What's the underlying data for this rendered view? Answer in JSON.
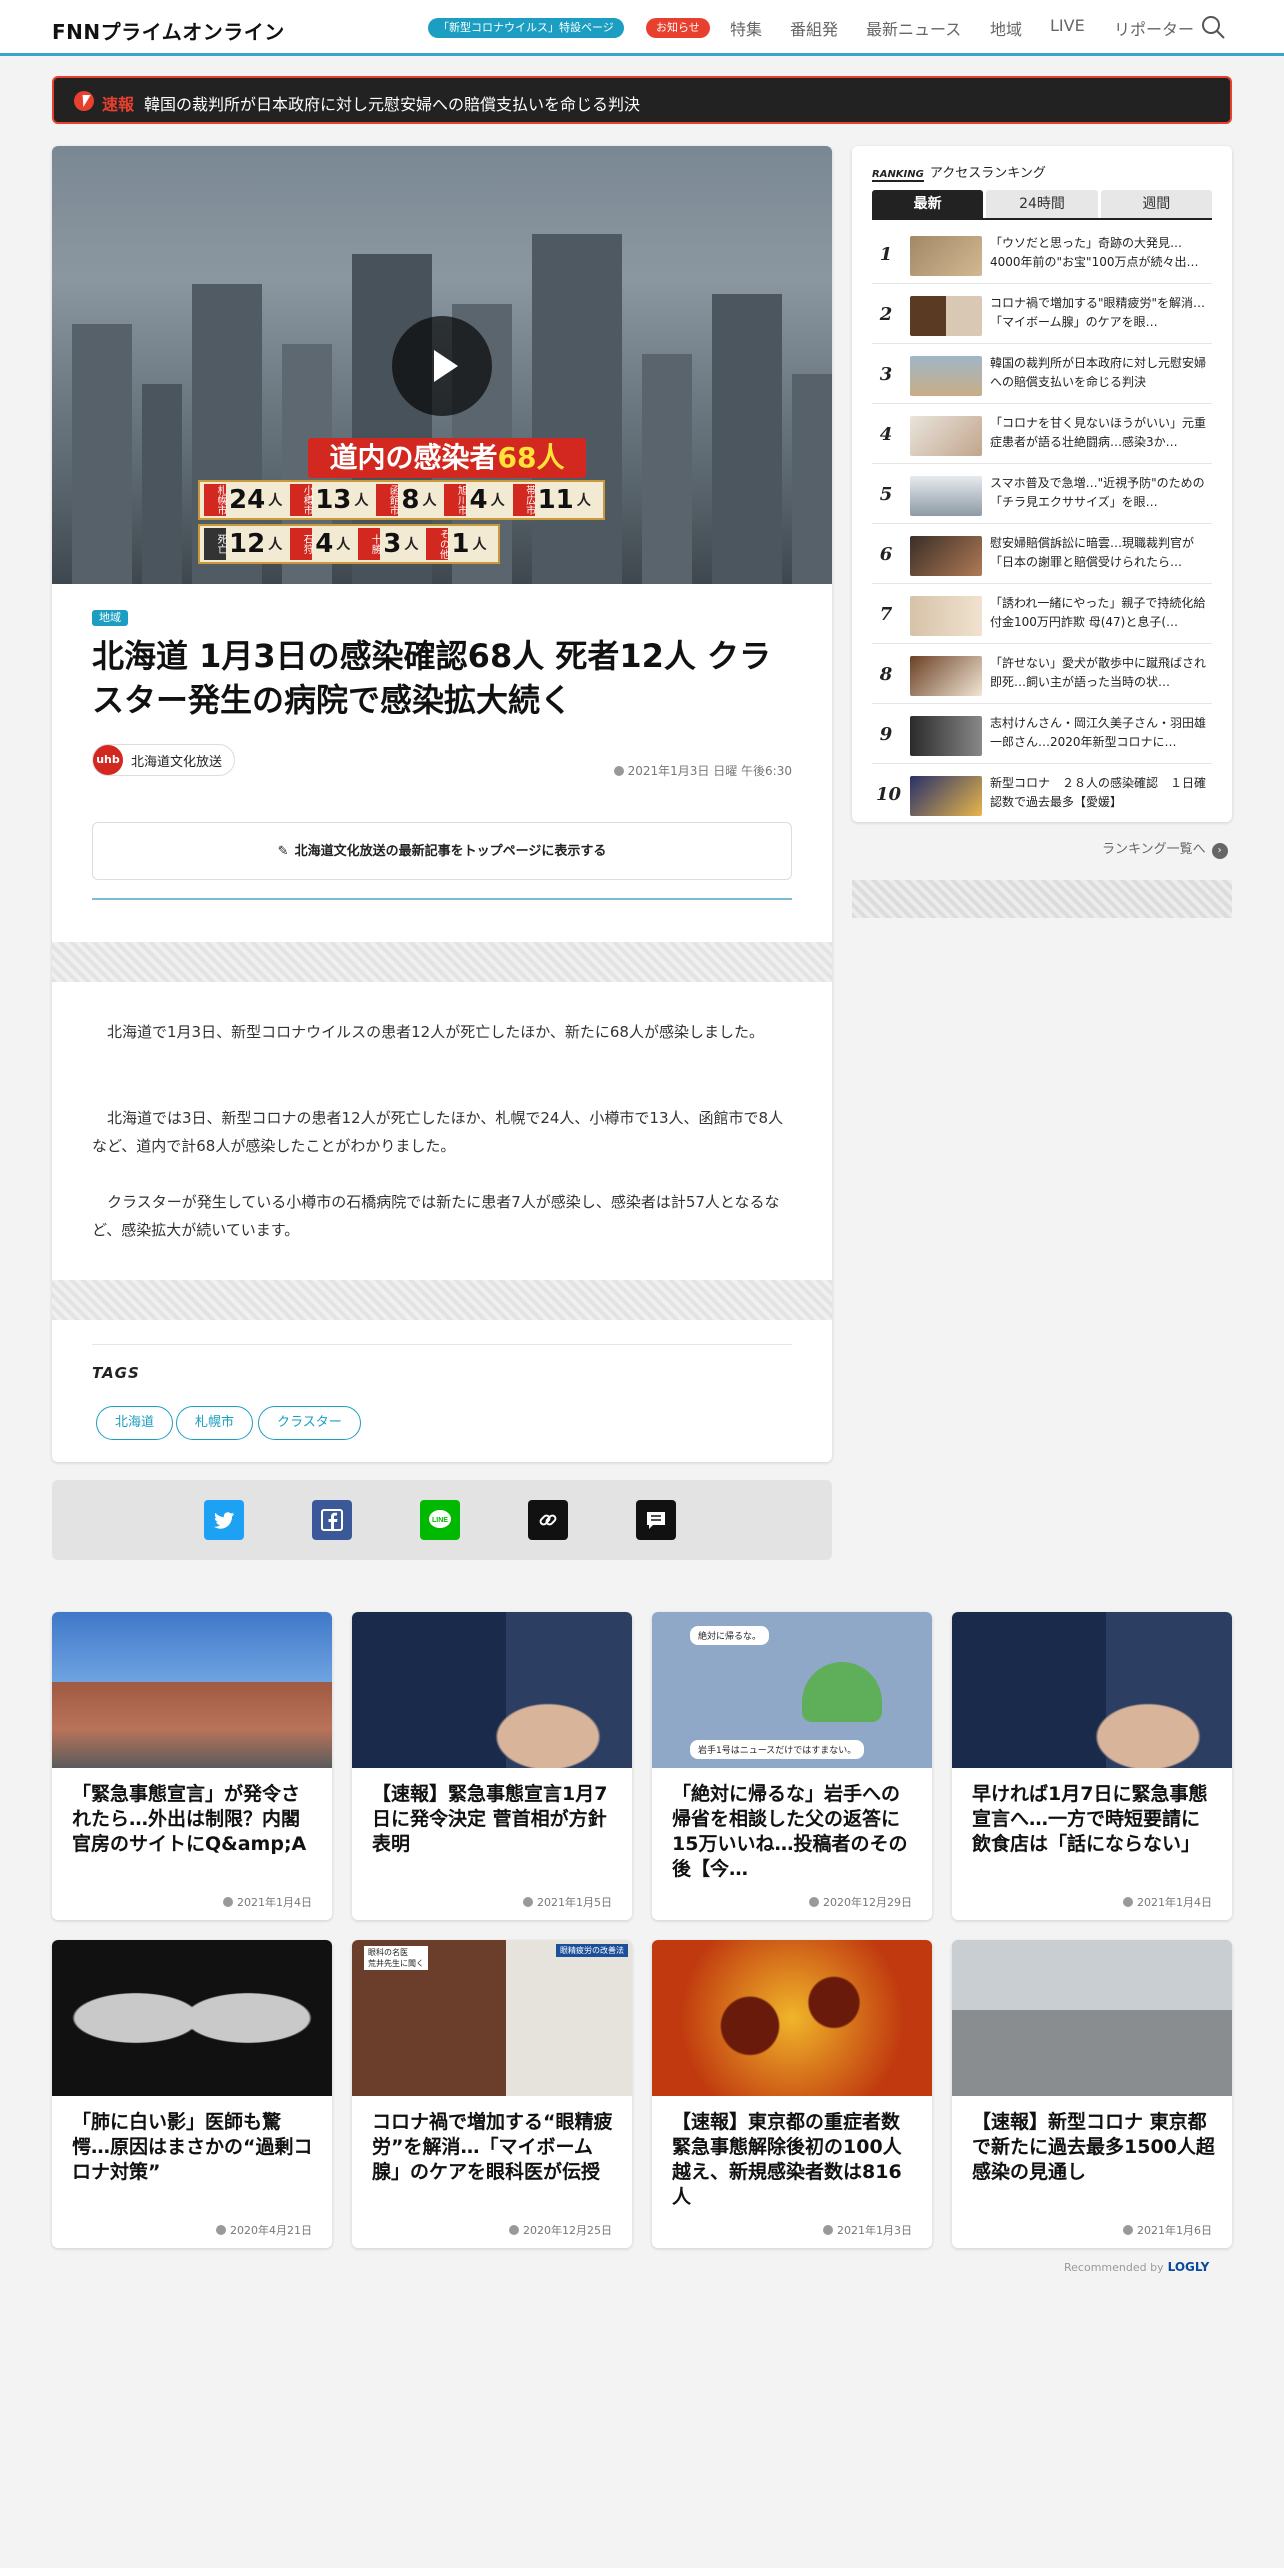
{
  "header": {
    "logo": "FNNプライムオンライン",
    "corona_pill": "「新型コロナウイルス」特設ページ",
    "notice_pill": "お知らせ",
    "nav": [
      "特集",
      "番組発",
      "最新ニュース",
      "地域",
      "LIVE",
      "リポーター"
    ]
  },
  "breaking": {
    "label": "速報",
    "text": "韓国の裁判所が日本政府に対し元慰安婦への賠償支払いを命じる判決"
  },
  "video": {
    "title_prefix": "道内の感染者",
    "title_num": "68人",
    "row1": [
      {
        "city": "札幌市",
        "num": "24",
        "unit": "人"
      },
      {
        "city": "小樽市",
        "num": "13",
        "unit": "人"
      },
      {
        "city": "函館市",
        "num": "8",
        "unit": "人"
      },
      {
        "city": "旭川市",
        "num": "4",
        "unit": "人"
      },
      {
        "city": "帯広市",
        "num": "11",
        "unit": "人"
      }
    ],
    "row2": [
      {
        "city": "死亡",
        "num": "12",
        "unit": "人"
      },
      {
        "city": "石狩",
        "num": "4",
        "unit": "人"
      },
      {
        "city": "十勝",
        "num": "3",
        "unit": "人"
      },
      {
        "city": "その他",
        "num": "1",
        "unit": "人"
      }
    ]
  },
  "article": {
    "category": "地域",
    "title": "北海道 1月3日の感染確認68人 死者12人 クラスター発生の病院で感染拡大続く",
    "publisher_logo": "uhb",
    "publisher": "北海道文化放送",
    "date": "2021年1月3日 日曜 午後6:30",
    "follow_button": "北海道文化放送の最新記事をトップページに表示する",
    "paragraphs": [
      "北海道で1月3日、新型コロナウイルスの患者12人が死亡したほか、新たに68人が感染しました。",
      "北海道では3日、新型コロナの患者12人が死亡したほか、札幌で24人、小樽市で13人、函館市で8人など、道内で計68人が感染したことがわかりました。",
      "クラスターが発生している小樽市の石橋病院では新たに患者7人が感染し、感染者は計57人となるなど、感染拡大が続いています。"
    ],
    "tags_heading": "TAGS",
    "tags": [
      "北海道",
      "札幌市",
      "クラスター"
    ]
  },
  "ranking": {
    "heading_en": "RANKING",
    "heading": "アクセスランキング",
    "tabs": [
      "最新",
      "24時間",
      "週間"
    ],
    "items": [
      {
        "rank": "1",
        "text": "「ウソだと思った」奇跡の大発見…4000年前の\"お宝\"100万点が続々出…"
      },
      {
        "rank": "2",
        "text": "コロナ禍で増加する\"眼精疲労\"を解消…「マイボーム腺」のケアを眼…"
      },
      {
        "rank": "3",
        "text": "韓国の裁判所が日本政府に対し元慰安婦への賠償支払いを命じる判決"
      },
      {
        "rank": "4",
        "text": "「コロナを甘く見ないほうがいい」元重症患者が語る壮絶闘病…感染3か…"
      },
      {
        "rank": "5",
        "text": "スマホ普及で急増…\"近視予防\"のための「チラ見エクササイズ」を眼…"
      },
      {
        "rank": "6",
        "text": "慰安婦賠償訴訟に暗雲…現職裁判官が「日本の謝罪と賠償受けられたら…"
      },
      {
        "rank": "7",
        "text": "「誘われ一緒にやった」親子で持続化給付金100万円詐欺 母(47)と息子(…"
      },
      {
        "rank": "8",
        "text": "「許せない」愛犬が散歩中に蹴飛ばされ即死…飼い主が語った当時の状…"
      },
      {
        "rank": "9",
        "text": "志村けんさん・岡江久美子さん・羽田雄一郎さん…2020年新型コロナに…"
      },
      {
        "rank": "10",
        "text": "新型コロナ　２８人の感染確認　１日確認数で過去最多【愛媛】"
      }
    ],
    "more": "ランキング一覧へ"
  },
  "recommend": {
    "cards": [
      {
        "title": "「緊急事態宣言」が発令されたら…外出は制限？内閣官房のサイトにQ&amp;A",
        "date": "2021年1月4日"
      },
      {
        "title": "【速報】緊急事態宣言1月7日に発令決定 菅首相が方針表明",
        "date": "2021年1月5日"
      },
      {
        "title": "「絶対に帰るな」岩手への帰省を相談した父の返答に15万いいね…投稿者のその後【今…",
        "date": "2020年12月29日"
      },
      {
        "title": "早ければ1月7日に緊急事態宣言へ…一方で時短要請に飲食店は「話にならない」",
        "date": "2021年1月4日"
      },
      {
        "title": "「肺に白い影」医師も驚愕…原因はまさかの“過剰コロナ対策”",
        "date": "2020年4月21日"
      },
      {
        "title": "コロナ禍で増加する“眼精疲労”を解消…「マイボーム腺」のケアを眼科医が伝授",
        "date": "2020年12月25日"
      },
      {
        "title": "【速報】東京都の重症者数 緊急事態解除後初の100人越え、新規感染者数は816人",
        "date": "2021年1月3日"
      },
      {
        "title": "【速報】新型コロナ 東京都で新たに過去最多1500人超感染の見通し",
        "date": "2021年1月6日"
      }
    ],
    "card_captions": {
      "chat_1": "絶対に帰るな。",
      "chat_2": "岩手1号はニュースだけではすまない。",
      "eye_1": "眼科の名医",
      "eye_2": "荒井先生に聞く",
      "eye_badge": "眼精疲労の改善法"
    },
    "recommended_by": "Recommended by",
    "logly": "LOGLY"
  },
  "colors": {
    "accent": "#1b9ec1",
    "alert": "#e8402f"
  }
}
